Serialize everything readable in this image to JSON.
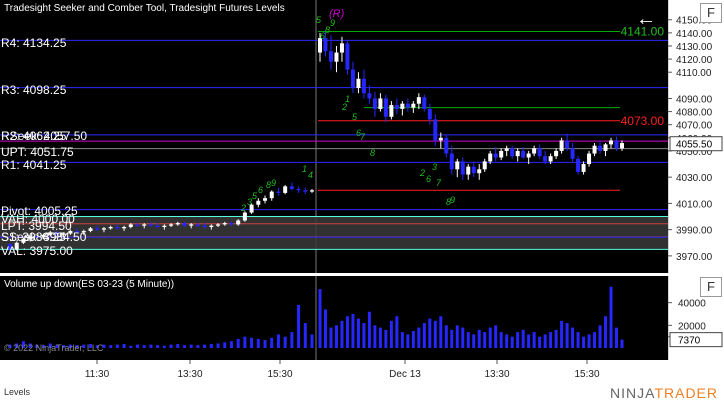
{
  "window": {
    "title": "Tradesight Seeker and Comber Tool, Tradesight Futures Levels",
    "back_icon": "back-arrow-icon",
    "config_button_label": "F"
  },
  "volume": {
    "title": "Volume up down(ES 03-23 (5 Minute))",
    "current_value": "7370",
    "config_button_label": "F"
  },
  "copyright": "© 2022 NinjaTrader, LLC",
  "footer": {
    "label": "Levels",
    "brand_ninja": "NINJA",
    "brand_trader": "TRADER"
  },
  "colors": {
    "background": "#000000",
    "up_candle": "#ffffff",
    "down_candle": "#2626ff",
    "level_line": "#2a2aff",
    "resistance_line": "#ff2020",
    "green_line": "#00aa00",
    "magenta_line": "#cc00cc",
    "value_area_fill": "#3a3a3a",
    "volume_bar": "#2626ff",
    "annotation_green": "#22bb22",
    "annotation_magenta": "#cc00cc"
  },
  "chart_data": {
    "type": "candlestick",
    "symbol": "ES 03-23",
    "interval": "5 Minute",
    "ylim": [
      3960,
      4162
    ],
    "price_ticks": [
      3970,
      3990,
      4010,
      4030,
      4050,
      4060,
      4070,
      4080,
      4090,
      4110,
      4120,
      4130,
      4140,
      4150
    ],
    "current_price": "4055.50",
    "time_ticks": [
      "11:30",
      "13:30",
      "15:30",
      "Dec 13",
      "13:30",
      "15:30"
    ],
    "level_labels": [
      {
        "text": "R4: 4134.25",
        "price": 4134.25
      },
      {
        "text": "R3: 4098.25",
        "price": 4098.25
      },
      {
        "text": "R2: 4062.25",
        "price": 4062.25
      },
      {
        "text": "RSeek: 4057.50",
        "price": 4057.5
      },
      {
        "text": "UPT: 4051.75",
        "price": 4051.75
      },
      {
        "text": "R1: 4041.25",
        "price": 4041.25
      },
      {
        "text": "Pivot: 4005.25",
        "price": 4005.25
      },
      {
        "text": "VAH: 4000.00",
        "price": 4000.0
      },
      {
        "text": "LPT: 3994.50",
        "price": 3994.5
      },
      {
        "text": "S1: 3984.25",
        "price": 3984.25
      },
      {
        "text": "SSeek: 3984.50",
        "price": 3984.5
      },
      {
        "text": "VAL: 3975.00",
        "price": 3975.0
      }
    ],
    "right_labels": [
      {
        "text": "4141.00",
        "price": 4141.0,
        "color": "#22bb22"
      },
      {
        "text": "4073.00",
        "price": 4073.0,
        "color": "#ff2020"
      }
    ],
    "annotations": [
      {
        "text": "(R)",
        "color": "#cc00cc"
      },
      {
        "text": "5",
        "color": "#22bb22"
      },
      {
        "text": "6",
        "color": "#22bb22"
      },
      {
        "text": "8",
        "color": "#22bb22"
      },
      {
        "text": "9",
        "color": "#22bb22"
      },
      {
        "text": "1",
        "color": "#22bb22"
      },
      {
        "text": "2",
        "color": "#22bb22"
      },
      {
        "text": "5",
        "color": "#22bb22"
      },
      {
        "text": "6",
        "color": "#22bb22"
      },
      {
        "text": "7",
        "color": "#22bb22"
      },
      {
        "text": "8",
        "color": "#22bb22"
      },
      {
        "text": "2",
        "color": "#22bb22"
      },
      {
        "text": "3",
        "color": "#22bb22"
      },
      {
        "text": "5",
        "color": "#22bb22"
      },
      {
        "text": "6",
        "color": "#22bb22"
      },
      {
        "text": "8",
        "color": "#22bb22"
      },
      {
        "text": "9",
        "color": "#22bb22"
      },
      {
        "text": "1",
        "color": "#22bb22"
      },
      {
        "text": "4",
        "color": "#22bb22"
      },
      {
        "text": "2",
        "color": "#22bb22"
      },
      {
        "text": "3",
        "color": "#22bb22"
      },
      {
        "text": "6",
        "color": "#22bb22"
      },
      {
        "text": "7",
        "color": "#22bb22"
      },
      {
        "text": "8",
        "color": "#22bb22"
      },
      {
        "text": "9",
        "color": "#22bb22"
      }
    ],
    "volume_ticks": [
      10000,
      20000,
      40000
    ],
    "volume_ylim": [
      0,
      60000
    ],
    "candles": [
      [
        3979,
        3980,
        3972,
        3975
      ],
      [
        3975,
        3981,
        3974,
        3980
      ],
      [
        3980,
        3984,
        3979,
        3983
      ],
      [
        3983,
        3986,
        3981,
        3985
      ],
      [
        3985,
        3986,
        3982,
        3984
      ],
      [
        3984,
        3987,
        3983,
        3986
      ],
      [
        3986,
        3989,
        3985,
        3988
      ],
      [
        3988,
        3989,
        3985,
        3986
      ],
      [
        3986,
        3988,
        3984,
        3987
      ],
      [
        3987,
        3990,
        3986,
        3989
      ],
      [
        3989,
        3991,
        3987,
        3988
      ],
      [
        3988,
        3990,
        3986,
        3989
      ],
      [
        3989,
        3992,
        3988,
        3991
      ],
      [
        3991,
        3993,
        3989,
        3990
      ],
      [
        3990,
        3992,
        3988,
        3991
      ],
      [
        3991,
        3993,
        3990,
        3992
      ],
      [
        3992,
        3994,
        3990,
        3991
      ],
      [
        3991,
        3993,
        3989,
        3992
      ],
      [
        3992,
        3995,
        3991,
        3994
      ],
      [
        3994,
        3995,
        3992,
        3993
      ],
      [
        3993,
        3995,
        3991,
        3994
      ],
      [
        3994,
        3996,
        3992,
        3993
      ],
      [
        3993,
        3995,
        3991,
        3992
      ],
      [
        3992,
        3994,
        3990,
        3993
      ],
      [
        3993,
        3995,
        3992,
        3994
      ],
      [
        3994,
        3996,
        3993,
        3995
      ],
      [
        3995,
        3996,
        3992,
        3993
      ],
      [
        3993,
        3995,
        3991,
        3994
      ],
      [
        3994,
        3995,
        3992,
        3993
      ],
      [
        3993,
        3995,
        3991,
        3992
      ],
      [
        3992,
        3994,
        3990,
        3993
      ],
      [
        3993,
        3995,
        3992,
        3994
      ],
      [
        3994,
        3996,
        3993,
        3995
      ],
      [
        3995,
        3996,
        3993,
        3994
      ],
      [
        3994,
        3998,
        3993,
        3997
      ],
      [
        3997,
        4004,
        3996,
        4003
      ],
      [
        4003,
        4010,
        4002,
        4009
      ],
      [
        4009,
        4014,
        4007,
        4012
      ],
      [
        4012,
        4016,
        4010,
        4014
      ],
      [
        4014,
        4020,
        4012,
        4019
      ],
      [
        4019,
        4022,
        4016,
        4018
      ],
      [
        4018,
        4024,
        4017,
        4023
      ],
      [
        4023,
        4026,
        4020,
        4021
      ],
      [
        4021,
        4023,
        4018,
        4020
      ],
      [
        4020,
        4022,
        4017,
        4019
      ],
      [
        4019,
        4021,
        4018,
        4020
      ],
      [
        4125,
        4140,
        4118,
        4136
      ],
      [
        4136,
        4142,
        4122,
        4126
      ],
      [
        4126,
        4138,
        4112,
        4118
      ],
      [
        4118,
        4130,
        4110,
        4125
      ],
      [
        4125,
        4137,
        4118,
        4132
      ],
      [
        4132,
        4134,
        4108,
        4112
      ],
      [
        4112,
        4118,
        4094,
        4098
      ],
      [
        4098,
        4110,
        4094,
        4105
      ],
      [
        4105,
        4112,
        4090,
        4094
      ],
      [
        4094,
        4100,
        4086,
        4090
      ],
      [
        4090,
        4095,
        4076,
        4082
      ],
      [
        4082,
        4094,
        4080,
        4090
      ],
      [
        4090,
        4093,
        4072,
        4076
      ],
      [
        4076,
        4088,
        4074,
        4085
      ],
      [
        4085,
        4090,
        4078,
        4082
      ],
      [
        4082,
        4088,
        4077,
        4086
      ],
      [
        4086,
        4090,
        4080,
        4083
      ],
      [
        4083,
        4088,
        4079,
        4086
      ],
      [
        4086,
        4094,
        4082,
        4091
      ],
      [
        4091,
        4093,
        4080,
        4082
      ],
      [
        4082,
        4086,
        4070,
        4074
      ],
      [
        4074,
        4078,
        4054,
        4058
      ],
      [
        4058,
        4064,
        4052,
        4060
      ],
      [
        4060,
        4062,
        4045,
        4048
      ],
      [
        4048,
        4054,
        4032,
        4036
      ],
      [
        4036,
        4044,
        4030,
        4042
      ],
      [
        4042,
        4045,
        4028,
        4032
      ],
      [
        4032,
        4040,
        4028,
        4038
      ],
      [
        4038,
        4042,
        4030,
        4033
      ],
      [
        4033,
        4040,
        4028,
        4036
      ],
      [
        4036,
        4044,
        4034,
        4042
      ],
      [
        4042,
        4050,
        4040,
        4048
      ],
      [
        4048,
        4053,
        4042,
        4045
      ],
      [
        4045,
        4052,
        4043,
        4050
      ],
      [
        4050,
        4054,
        4046,
        4052
      ],
      [
        4052,
        4054,
        4044,
        4046
      ],
      [
        4046,
        4052,
        4042,
        4050
      ],
      [
        4050,
        4053,
        4044,
        4045
      ],
      [
        4045,
        4050,
        4040,
        4048
      ],
      [
        4048,
        4054,
        4046,
        4052
      ],
      [
        4052,
        4055,
        4044,
        4046
      ],
      [
        4046,
        4050,
        4040,
        4042
      ],
      [
        4042,
        4048,
        4040,
        4046
      ],
      [
        4046,
        4052,
        4044,
        4050
      ],
      [
        4050,
        4060,
        4048,
        4058
      ],
      [
        4058,
        4063,
        4050,
        4052
      ],
      [
        4052,
        4056,
        4042,
        4044
      ],
      [
        4044,
        4046,
        4032,
        4034
      ],
      [
        4034,
        4042,
        4032,
        4040
      ],
      [
        4040,
        4050,
        4038,
        4048
      ],
      [
        4048,
        4056,
        4046,
        4054
      ],
      [
        4054,
        4058,
        4048,
        4050
      ],
      [
        4050,
        4056,
        4046,
        4055
      ],
      [
        4055,
        4060,
        4052,
        4058
      ],
      [
        4058,
        4061,
        4050,
        4052
      ],
      [
        4052,
        4058,
        4050,
        4056
      ]
    ],
    "volumes": [
      3000,
      4000,
      6000,
      4000,
      3000,
      2500,
      4000,
      3000,
      2500,
      3000,
      2500,
      3000,
      3500,
      2500,
      3000,
      2500,
      3000,
      3500,
      2000,
      3000,
      2500,
      3000,
      2500,
      2000,
      3000,
      3500,
      2500,
      3000,
      2500,
      3000,
      3500,
      4000,
      5000,
      6000,
      8000,
      10000,
      9000,
      8000,
      7000,
      9000,
      12000,
      10000,
      14000,
      38000,
      22000,
      12000,
      52000,
      34000,
      18000,
      20000,
      24000,
      28000,
      30000,
      26000,
      22000,
      32000,
      20000,
      18000,
      16000,
      24000,
      28000,
      14000,
      12000,
      15000,
      18000,
      22000,
      26000,
      24000,
      28000,
      20000,
      16000,
      20000,
      18000,
      14000,
      12000,
      16000,
      14000,
      18000,
      20000,
      14000,
      12000,
      10000,
      14000,
      16000,
      12000,
      14000,
      10000,
      12000,
      14000,
      16000,
      24000,
      22000,
      18000,
      14000,
      10000,
      12000,
      14000,
      20000,
      28000,
      54000,
      18000,
      7370
    ]
  }
}
